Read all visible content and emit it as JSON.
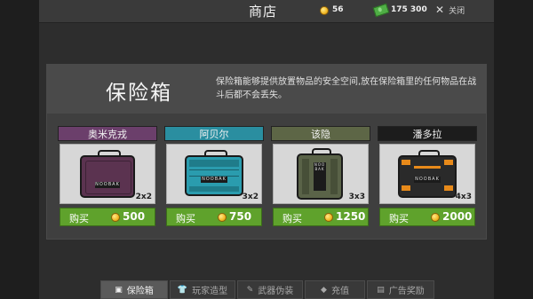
{
  "top_bar": {
    "title": "商店",
    "coins": "56",
    "cash": "175 300",
    "close_label": "关闭"
  },
  "panel": {
    "title": "保险箱",
    "description": "保险箱能够提供放置物品的安全空间,放在保险箱里的任何物品在战斗后都不会丢失。"
  },
  "cards": [
    {
      "name": "奥米克戎",
      "size": "2x2",
      "buy_label": "购买",
      "price": "500",
      "name_bg": "#6b3f6b",
      "case_color": "#5b3350"
    },
    {
      "name": "阿贝尔",
      "size": "3x2",
      "buy_label": "购买",
      "price": "750",
      "name_bg": "#2a8ea0",
      "case_color": "#2a9cae"
    },
    {
      "name": "该隐",
      "size": "3x3",
      "buy_label": "购买",
      "price": "1250",
      "name_bg": "#5d6646",
      "case_color": "#5a6348"
    },
    {
      "name": "潘多拉",
      "size": "4x3",
      "buy_label": "购买",
      "price": "2000",
      "name_bg": "#1c1c1c",
      "case_color": "#2a2a2a"
    }
  ],
  "tabs": [
    {
      "label": "保险箱",
      "icon": "safe-box-icon",
      "active": true
    },
    {
      "label": "玩家造型",
      "icon": "shirt-icon",
      "active": false
    },
    {
      "label": "武器伪装",
      "icon": "brush-icon",
      "active": false
    },
    {
      "label": "充值",
      "icon": "diamond-icon",
      "active": false
    },
    {
      "label": "广告奖励",
      "icon": "gift-icon",
      "active": false
    }
  ],
  "colors": {
    "buy_button": "#5fa22c",
    "accent_orange": "#e88a1a",
    "coin": "#f1b824"
  }
}
